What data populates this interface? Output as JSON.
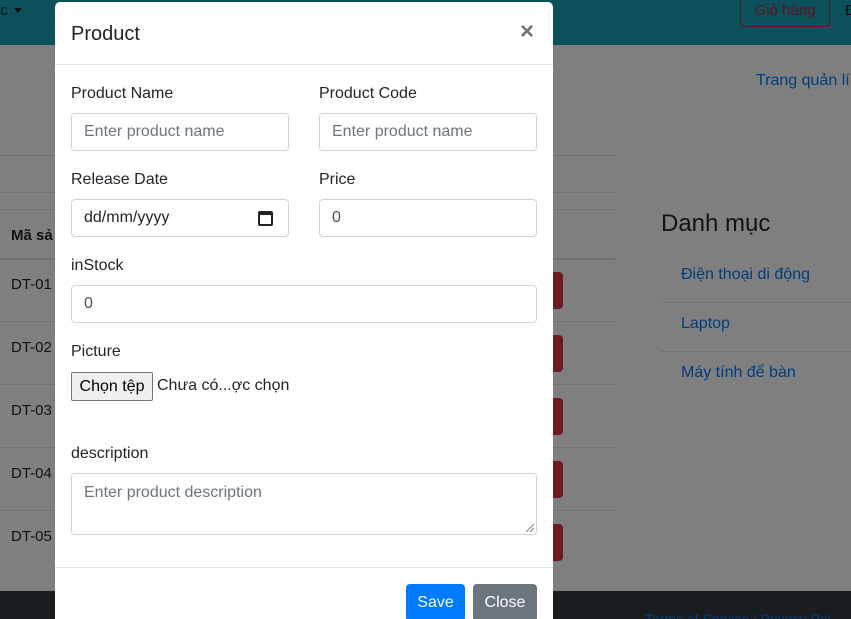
{
  "navbar": {
    "category_menu": "ục",
    "cart_label": "Giỏ hàng",
    "extra": "Đ"
  },
  "admin_link": "Trang quản lí",
  "table": {
    "header_code": "Mã sả",
    "rows": [
      "DT-01",
      "DT-02",
      "DT-03",
      "DT-04",
      "DT-05"
    ]
  },
  "categories": {
    "title": "Danh mục",
    "items": [
      "Điện thoại di động",
      "Laptop",
      "Máy tính để bàn"
    ]
  },
  "footer": {
    "link": "Terms of Service | Privacy Pol"
  },
  "modal": {
    "title": "Product",
    "close_symbol": "×",
    "product_name": {
      "label": "Product Name",
      "placeholder": "Enter product name"
    },
    "product_code": {
      "label": "Product Code",
      "placeholder": "Enter product name"
    },
    "release_date": {
      "label": "Release Date",
      "placeholder": "dd/mm/yyyy"
    },
    "price": {
      "label": "Price",
      "value": "0"
    },
    "instock": {
      "label": "inStock",
      "value": "0"
    },
    "picture": {
      "label": "Picture",
      "button": "Chọn tệp",
      "status": "Chưa có...ợc chọn"
    },
    "description": {
      "label": "description",
      "placeholder": "Enter product description"
    },
    "save_label": "Save",
    "close_label": "Close"
  },
  "colors": {
    "navbar": "#17a2b8",
    "primary": "#007bff",
    "danger": "#dc3545",
    "secondary": "#6c757d",
    "footer": "#343a40"
  }
}
